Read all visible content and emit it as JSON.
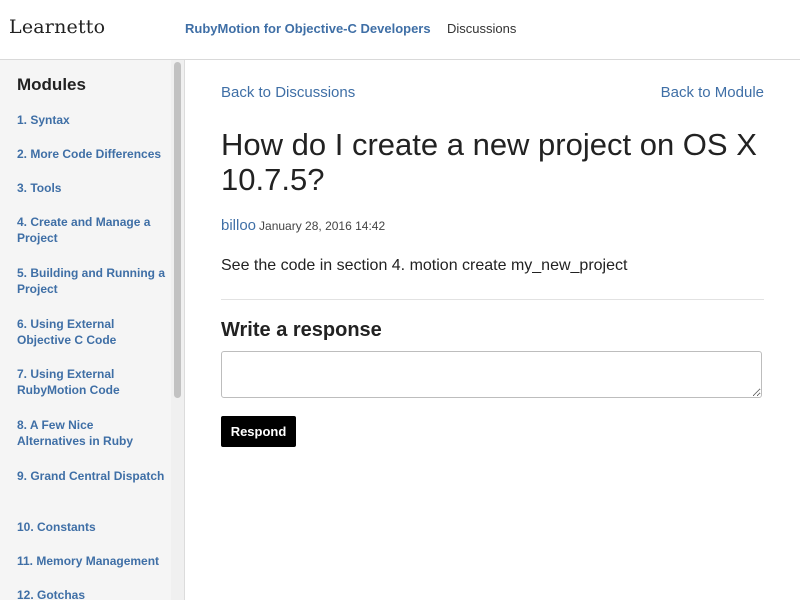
{
  "header": {
    "logo": "Learnetto",
    "course_link": "RubyMotion for Objective-C Developers",
    "discussions_link": "Discussions"
  },
  "sidebar": {
    "title": "Modules",
    "items": [
      {
        "label": "1. Syntax"
      },
      {
        "label": "2. More Code Differences"
      },
      {
        "label": "3. Tools"
      },
      {
        "label": "4. Create and Manage a Project"
      },
      {
        "label": "5. Building and Running a Project"
      },
      {
        "label": "6. Using External Objective C Code"
      },
      {
        "label": "7. Using External RubyMotion Code"
      },
      {
        "label": "8. A Few Nice Alternatives in Ruby"
      },
      {
        "label": "9. Grand Central Dispatch"
      },
      {
        "label": "10. Constants"
      },
      {
        "label": "11. Memory Management"
      },
      {
        "label": "12. Gotchas"
      }
    ]
  },
  "main": {
    "back_discussions": "Back to Discussions",
    "back_module": "Back to Module",
    "question_title": "How do I create a new project on OS X 10.7.5?",
    "author": "billoo",
    "date": "January 28, 2016 14:42",
    "body": "See the code in section 4. motion create my_new_project",
    "response_heading": "Write a response",
    "response_value": "",
    "respond_button": "Respond"
  },
  "colors": {
    "link": "#3f6fa6",
    "button_bg": "#000000"
  }
}
